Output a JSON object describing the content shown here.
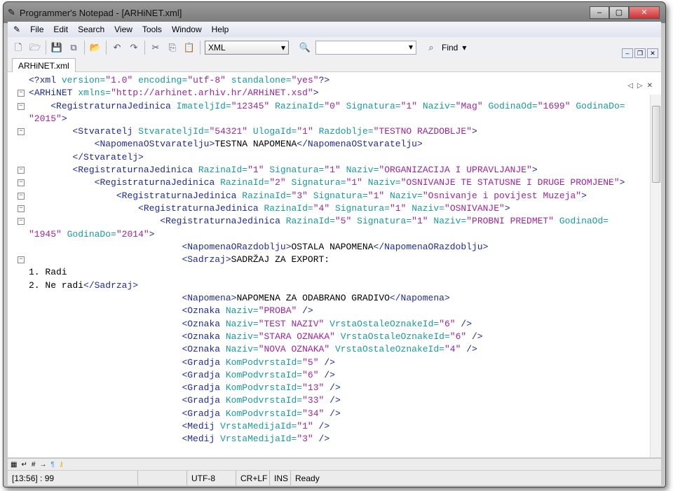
{
  "window": {
    "title": "Programmer's Notepad - [ARHiNET.xml]"
  },
  "menu": [
    "File",
    "Edit",
    "Search",
    "View",
    "Tools",
    "Window",
    "Help"
  ],
  "toolbar": {
    "icons": [
      "new-file-icon",
      "open-file-icon",
      "save-icon",
      "save-all-icon",
      "open-folder-icon",
      "undo-icon",
      "redo-icon",
      "cut-icon",
      "copy-icon",
      "paste-icon"
    ],
    "scheme": "XML",
    "find_value": "",
    "find_label": "Find"
  },
  "tabs": [
    {
      "label": "ARHiNET.xml"
    }
  ],
  "colors": {
    "tag": "#1e2a9a",
    "attr": "#1a9a9a",
    "value": "#a0249a",
    "text": "#000000"
  },
  "code": [
    {
      "indent": 0,
      "fold": false,
      "text": "<?xml version=\"1.0\" encoding=\"utf-8\" standalone=\"yes\"?>"
    },
    {
      "indent": 0,
      "fold": true,
      "text": "<ARHiNET xmlns=\"http://arhinet.arhiv.hr/ARHiNET.xsd\">"
    },
    {
      "indent": 1,
      "fold": true,
      "text": "<RegistraturnaJedinica ImateljId=\"12345\" RazinaId=\"0\" Signatura=\"1\" Naziv=\"Mag\" GodinaOd=\"1699\" GodinaDo="
    },
    {
      "indent": 0,
      "fold": false,
      "text": "\"2015\">"
    },
    {
      "indent": 2,
      "fold": true,
      "text": "<Stvaratelj StvarateljId=\"54321\" UlogaId=\"1\" Razdoblje=\"TESTNO RAZDOBLJE\">"
    },
    {
      "indent": 3,
      "fold": false,
      "text": "<NapomenaOStvaratelju>TESTNA NAPOMENA</NapomenaOStvaratelju>"
    },
    {
      "indent": 2,
      "fold": false,
      "text": "</Stvaratelj>"
    },
    {
      "indent": 2,
      "fold": true,
      "text": "<RegistraturnaJedinica RazinaId=\"1\" Signatura=\"1\" Naziv=\"ORGANIZACIJA I UPRAVLJANJE\">"
    },
    {
      "indent": 3,
      "fold": true,
      "text": "<RegistraturnaJedinica RazinaId=\"2\" Signatura=\"1\" Naziv=\"OSNIVANJE TE STATUSNE I DRUGE PROMJENE\">"
    },
    {
      "indent": 4,
      "fold": true,
      "text": "<RegistraturnaJedinica RazinaId=\"3\" Signatura=\"1\" Naziv=\"Osnivanje i povijest Muzeja\">"
    },
    {
      "indent": 5,
      "fold": true,
      "text": "<RegistraturnaJedinica RazinaId=\"4\" Signatura=\"1\" Naziv=\"OSNIVANJE\">"
    },
    {
      "indent": 6,
      "fold": true,
      "text": "<RegistraturnaJedinica RazinaId=\"5\" Signatura=\"1\" Naziv=\"PROBNI PREDMET\" GodinaOd="
    },
    {
      "indent": 0,
      "fold": false,
      "text": "\"1945\" GodinaDo=\"2014\">"
    },
    {
      "indent": 7,
      "fold": false,
      "text": "<NapomenaORazdoblju>OSTALA NAPOMENA</NapomenaORazdoblju>"
    },
    {
      "indent": 7,
      "fold": true,
      "text": "<Sadrzaj>SADRŽAJ ZA EXPORT:"
    },
    {
      "indent": 0,
      "fold": false,
      "text": "1. Radi"
    },
    {
      "indent": 0,
      "fold": false,
      "text": "2. Ne radi</Sadrzaj>"
    },
    {
      "indent": 7,
      "fold": false,
      "text": "<Napomena>NAPOMENA ZA ODABRANO GRADIVO</Napomena>"
    },
    {
      "indent": 7,
      "fold": false,
      "text": "<Oznaka Naziv=\"PROBA\" />"
    },
    {
      "indent": 7,
      "fold": false,
      "text": "<Oznaka Naziv=\"TEST NAZIV\" VrstaOstaleOznakeId=\"6\" />"
    },
    {
      "indent": 7,
      "fold": false,
      "text": "<Oznaka Naziv=\"STARA OZNAKA\" VrstaOstaleOznakeId=\"6\" />"
    },
    {
      "indent": 7,
      "fold": false,
      "text": "<Oznaka Naziv=\"NOVA OZNAKA\" VrstaOstaleOznakeId=\"4\" />"
    },
    {
      "indent": 7,
      "fold": false,
      "text": "<Gradja KomPodvrstaId=\"5\" />"
    },
    {
      "indent": 7,
      "fold": false,
      "text": "<Gradja KomPodvrstaId=\"6\" />"
    },
    {
      "indent": 7,
      "fold": false,
      "text": "<Gradja KomPodvrstaId=\"13\" />"
    },
    {
      "indent": 7,
      "fold": false,
      "text": "<Gradja KomPodvrstaId=\"33\" />"
    },
    {
      "indent": 7,
      "fold": false,
      "text": "<Gradja KomPodvrstaId=\"34\" />"
    },
    {
      "indent": 7,
      "fold": false,
      "text": "<Medij VrstaMedijaId=\"1\" />"
    },
    {
      "indent": 7,
      "fold": false,
      "text": "<Medij VrstaMedijaId=\"3\" />"
    }
  ],
  "status": {
    "position": "[13:56] : 99",
    "blank": "",
    "encoding": "UTF-8",
    "line_endings": "CR+LF",
    "mode": "INS",
    "message": "Ready"
  }
}
